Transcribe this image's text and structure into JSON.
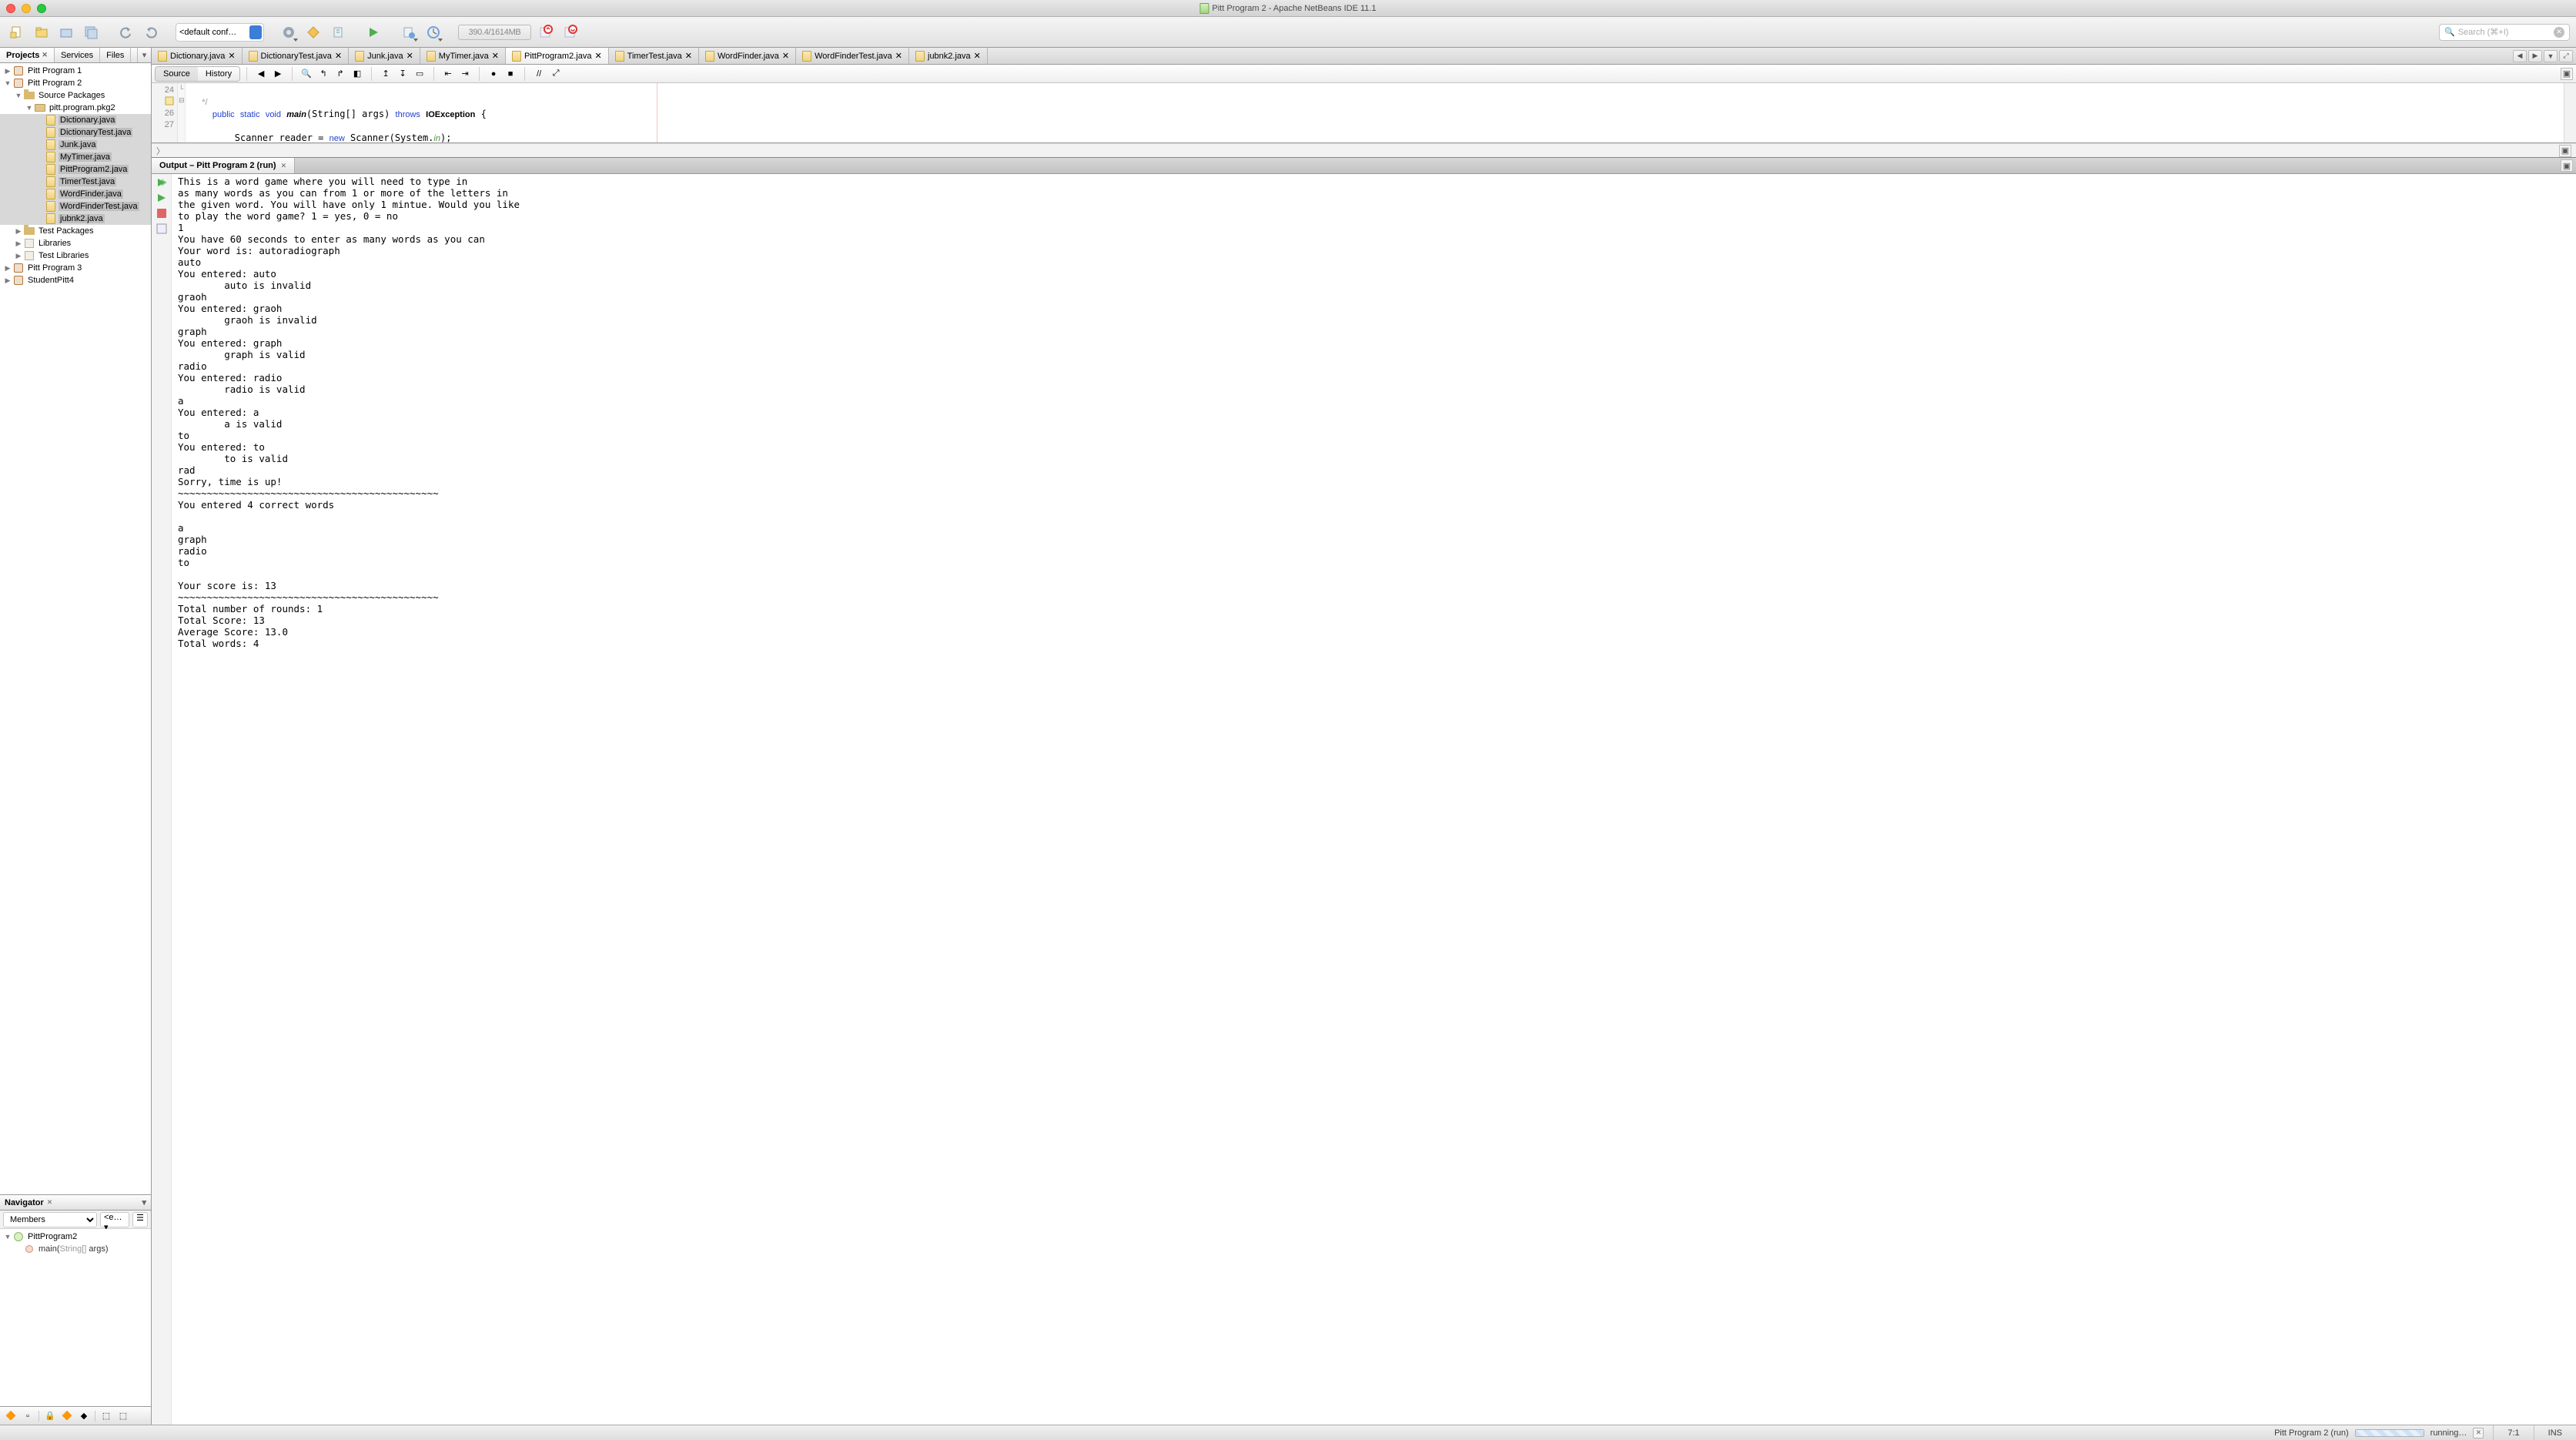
{
  "title": "Pitt Program 2 - Apache NetBeans IDE 11.1",
  "toolbar": {
    "config": "<default conf…",
    "memory": "390.4/1614MB",
    "search_placeholder": "Search (⌘+I)"
  },
  "left_panel": {
    "tabs": [
      "Projects",
      "Services",
      "Files"
    ],
    "active_tab": "Projects",
    "projects": [
      {
        "name": "Pitt Program 1",
        "expanded": false
      },
      {
        "name": "Pitt Program 2",
        "expanded": true,
        "children": [
          {
            "name": "Source Packages",
            "expanded": true,
            "kind": "source",
            "children": [
              {
                "name": "pitt.program.pkg2",
                "expanded": true,
                "kind": "package",
                "children": [
                  {
                    "name": "Dictionary.java",
                    "sel": true
                  },
                  {
                    "name": "DictionaryTest.java",
                    "sel": true
                  },
                  {
                    "name": "Junk.java",
                    "sel": true
                  },
                  {
                    "name": "MyTimer.java",
                    "sel": true
                  },
                  {
                    "name": "PittProgram2.java",
                    "sel": true
                  },
                  {
                    "name": "TimerTest.java",
                    "sel": true
                  },
                  {
                    "name": "WordFinder.java",
                    "sel": true
                  },
                  {
                    "name": "WordFinderTest.java",
                    "sel": true
                  },
                  {
                    "name": "jubnk2.java",
                    "sel": true
                  }
                ]
              }
            ]
          },
          {
            "name": "Test Packages",
            "kind": "source"
          },
          {
            "name": "Libraries",
            "kind": "lib"
          },
          {
            "name": "Test Libraries",
            "kind": "lib"
          }
        ]
      },
      {
        "name": "Pitt Program 3",
        "expanded": false
      },
      {
        "name": "StudentPitt4",
        "expanded": false
      }
    ]
  },
  "navigator": {
    "title": "Navigator",
    "mode": "Members",
    "filter": "<e…",
    "class": "PittProgram2",
    "members": [
      {
        "sig": "main(String[] args)"
      }
    ]
  },
  "editor": {
    "tabs": [
      "Dictionary.java",
      "DictionaryTest.java",
      "Junk.java",
      "MyTimer.java",
      "PittProgram2.java",
      "TimerTest.java",
      "WordFinder.java",
      "WordFinderTest.java",
      "jubnk2.java"
    ],
    "active_tab": "PittProgram2.java",
    "views": {
      "source": "Source",
      "history": "History"
    },
    "line_numbers": [
      "24",
      "",
      "26",
      "27"
    ],
    "code_lines": [
      "     */",
      "    public static void main(String[] args) throws IOException {",
      "",
      "        Scanner reader = new Scanner(System.in);"
    ]
  },
  "output": {
    "tab_title": "Output – Pitt Program 2 (run)",
    "text": "This is a word game where you will need to type in\nas many words as you can from 1 or more of the letters in\nthe given word. You will have only 1 mintue. Would you like\nto play the word game? 1 = yes, 0 = no\n1\nYou have 60 seconds to enter as many words as you can\nYour word is: autoradiograph\nauto\nYou entered: auto\n        auto is invalid\ngraoh\nYou entered: graoh\n        graoh is invalid\ngraph\nYou entered: graph\n        graph is valid\nradio\nYou entered: radio\n        radio is valid\na\nYou entered: a\n        a is valid\nto\nYou entered: to\n        to is valid\nrad\nSorry, time is up!\n~~~~~~~~~~~~~~~~~~~~~~~~~~~~~~~~~~~~~~~~~~~~~\nYou entered 4 correct words\n\na\ngraph\nradio\nto\n\nYour score is: 13\n~~~~~~~~~~~~~~~~~~~~~~~~~~~~~~~~~~~~~~~~~~~~~\nTotal number of rounds: 1\nTotal Score: 13\nAverage Score: 13.0\nTotal words: 4"
  },
  "status": {
    "task_name": "Pitt Program 2 (run)",
    "task_state": "running…",
    "caret": "7:1",
    "mode": "INS"
  }
}
